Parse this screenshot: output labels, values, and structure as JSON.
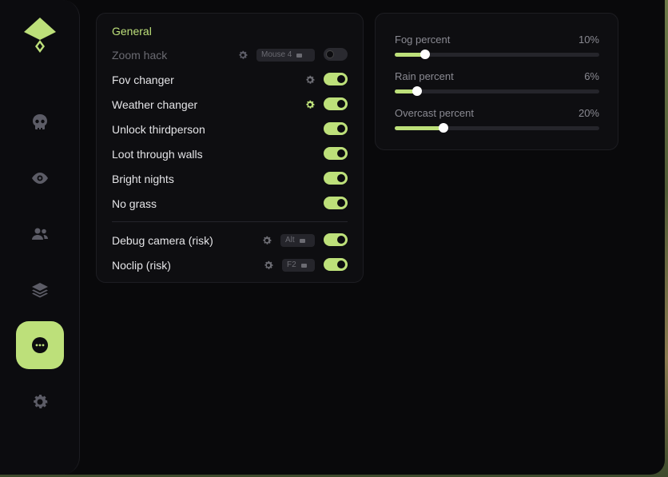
{
  "colors": {
    "accent": "#bde07a",
    "bg": "#09090b",
    "panel": "#0e0e11"
  },
  "sidebar": {
    "items": [
      {
        "icon": "skull-icon"
      },
      {
        "icon": "eye-icon"
      },
      {
        "icon": "users-icon"
      },
      {
        "icon": "layers-icon"
      },
      {
        "icon": "more-icon",
        "active": true
      },
      {
        "icon": "gear-icon"
      }
    ]
  },
  "general": {
    "title": "General",
    "rows": [
      {
        "label": "Zoom hack",
        "enabled": false,
        "has_gear": true,
        "key": "Mouse 4",
        "disabled": true
      },
      {
        "label": "Fov changer",
        "enabled": true,
        "has_gear": true
      },
      {
        "label": "Weather changer",
        "enabled": true,
        "has_gear": true,
        "gear_active": true
      },
      {
        "label": "Unlock thirdperson",
        "enabled": true
      },
      {
        "label": "Loot through walls",
        "enabled": true
      },
      {
        "label": "Bright nights",
        "enabled": true
      },
      {
        "label": "No grass",
        "enabled": true
      },
      {
        "label": "Debug camera (risk)",
        "enabled": true,
        "has_gear": true,
        "key": "Alt"
      },
      {
        "label": "Noclip (risk)",
        "enabled": true,
        "has_gear": true,
        "key": "F2"
      }
    ]
  },
  "sliders": [
    {
      "label": "Fog percent",
      "value_text": "10%",
      "value": 0.15
    },
    {
      "label": "Rain percent",
      "value_text": "6%",
      "value": 0.11
    },
    {
      "label": "Overcast percent",
      "value_text": "20%",
      "value": 0.24
    }
  ]
}
